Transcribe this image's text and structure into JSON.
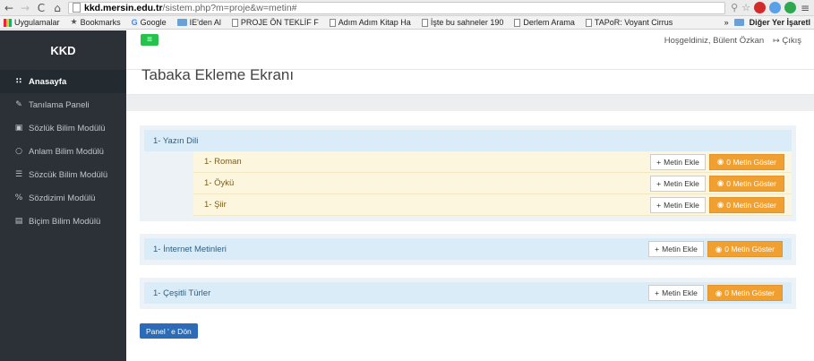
{
  "browser": {
    "url_host": "kkd.mersin.edu.tr",
    "url_path": "/sistem.php?m=proje&w=metin#",
    "bookmarks": [
      {
        "label": "Uygulamalar",
        "icon": "apps-grid"
      },
      {
        "label": "Bookmarks",
        "icon": "star"
      },
      {
        "label": "Google",
        "icon": "google-g"
      },
      {
        "label": "IE'den Al",
        "icon": "folder"
      },
      {
        "label": "PROJE ÖN TEKLİF F",
        "icon": "page"
      },
      {
        "label": "Adım Adım Kitap Ha",
        "icon": "page"
      },
      {
        "label": "İşte bu sahneler 190",
        "icon": "page"
      },
      {
        "label": "Derlem Arama",
        "icon": "page"
      },
      {
        "label": "TAPoR: Voyant Cirrus",
        "icon": "page"
      }
    ],
    "bookmarks_overflow": "»",
    "other_bookmarks": "Diğer Yer İşaretl"
  },
  "sidebar": {
    "brand": "KKD",
    "items": [
      {
        "label": "Anasayfa",
        "icon": "grid-icon",
        "active": true
      },
      {
        "label": "Tanılama Paneli",
        "icon": "pencil-icon"
      },
      {
        "label": "Sözlük Bilim Modülü",
        "icon": "book-icon"
      },
      {
        "label": "Anlam Bilim Modülü",
        "icon": "circle-icon"
      },
      {
        "label": "Sözcük Bilim Modülü",
        "icon": "list-icon"
      },
      {
        "label": "Sözdizimi Modülü",
        "icon": "percent-icon"
      },
      {
        "label": "Biçim Bilim Modülü",
        "icon": "file-icon"
      }
    ]
  },
  "header": {
    "welcome": "Hoşgeldiniz, Bülent Özkan",
    "logout": "Çıkış"
  },
  "page": {
    "title": "Tabaka Ekleme Ekranı",
    "back_button": "Panel ' e Dön"
  },
  "groups": [
    {
      "title": "1- Yazın Dili",
      "children": [
        {
          "label": "1- Roman",
          "add": "Metin Ekle",
          "show": "0 Metin Göster"
        },
        {
          "label": "1- Öykü",
          "add": "Metin Ekle",
          "show": "0 Metin Göster"
        },
        {
          "label": "1- Şiir",
          "add": "Metin Ekle",
          "show": "0 Metin Göster"
        }
      ]
    },
    {
      "title": "1- İnternet Metinleri",
      "add": "Metin Ekle",
      "show": "0 Metin Göster"
    },
    {
      "title": "1- Çeşitli Türler",
      "add": "Metin Ekle",
      "show": "0 Metin Göster"
    }
  ],
  "colors": {
    "sidebar": "#2b3137",
    "menu_button": "#27c24c",
    "show_button": "#f0a030",
    "back_button": "#2c6bb5",
    "row_head": "#d9ecf8",
    "sub_row": "#fcf6de"
  }
}
